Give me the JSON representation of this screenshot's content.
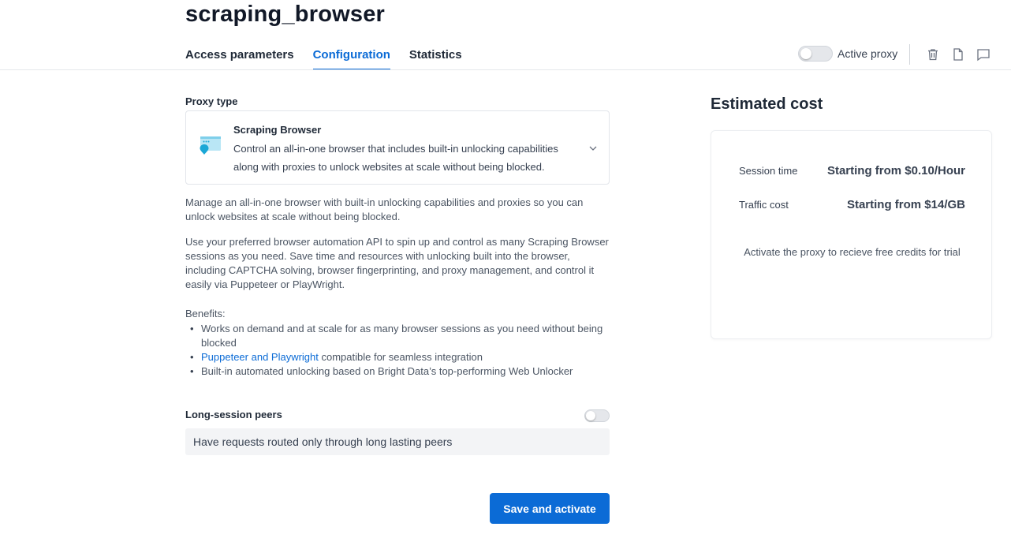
{
  "page": {
    "title": "scraping_browser"
  },
  "tabs": [
    {
      "label": "Access parameters",
      "active": false
    },
    {
      "label": "Configuration",
      "active": true
    },
    {
      "label": "Statistics",
      "active": false
    }
  ],
  "header_actions": {
    "active_proxy_label": "Active proxy",
    "active_proxy_on": false,
    "icons": [
      "trash-icon",
      "document-icon",
      "comment-icon"
    ]
  },
  "proxy_type": {
    "label": "Proxy type",
    "selected_name": "Scraping Browser",
    "selected_description": "Control an all-in-one browser that includes built-in unlocking capabilities along with proxies to unlock websites at scale without being blocked."
  },
  "description": {
    "para1": "Manage an all-in-one browser with built-in unlocking capabilities and proxies so you can unlock websites at scale without being blocked.",
    "para2": "Use your preferred browser automation API to spin up and control as many Scraping Browser sessions as you need. Save time and resources with unlocking built into the browser, including CAPTCHA solving, browser fingerprinting, and proxy management, and control it easily via Puppeteer or PlayWright.",
    "benefits_title": "Benefits:",
    "benefit1": "Works on demand and at scale for as many browser sessions as you need without being blocked",
    "benefit2_link": "Puppeteer and Playwright",
    "benefit2_rest": " compatible for seamless integration",
    "benefit3": "Built-in automated unlocking based on Bright Data’s top-performing Web Unlocker"
  },
  "long_session": {
    "label": "Long-session peers",
    "enabled": false,
    "description": "Have requests routed only through long lasting peers"
  },
  "save_button": "Save and activate",
  "estimated_cost": {
    "title": "Estimated cost",
    "rows": [
      {
        "key": "Session time",
        "value": "Starting from $0.10/Hour"
      },
      {
        "key": "Traffic cost",
        "value": "Starting from $14/GB"
      }
    ],
    "note": "Activate the proxy to recieve free credits for trial"
  },
  "colors": {
    "accent": "#0b6bd6",
    "text": "#1f2937"
  }
}
